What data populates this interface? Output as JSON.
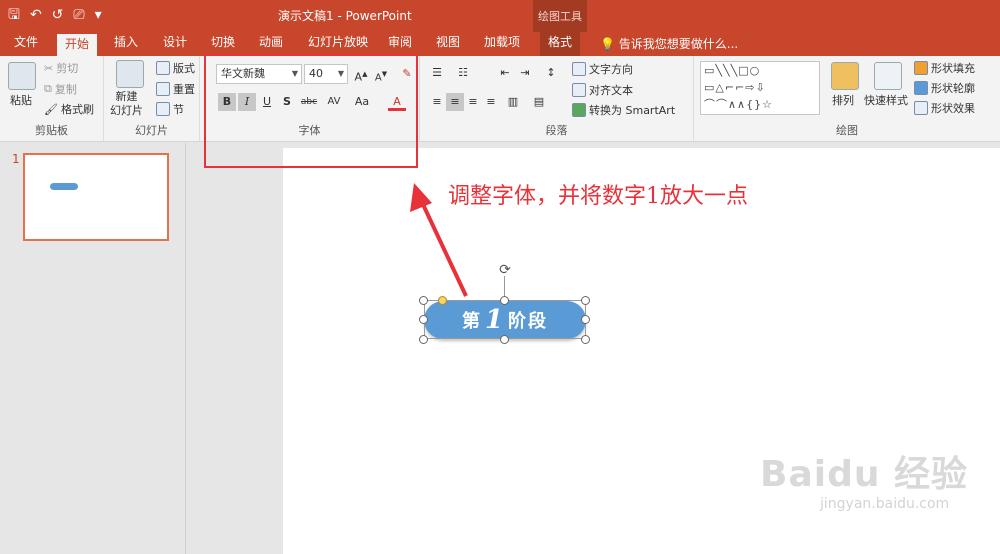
{
  "titlebar": {
    "title": "演示文稿1 - PowerPoint",
    "contextual_group": "绘图工具",
    "qat": {
      "save_icon": "save-icon",
      "undo_icon": "undo-icon",
      "redo_icon": "redo-icon",
      "start_icon": "start-from-beginning-icon",
      "customize": "▾"
    }
  },
  "tabs": [
    {
      "label": "文件"
    },
    {
      "label": "开始"
    },
    {
      "label": "插入"
    },
    {
      "label": "设计"
    },
    {
      "label": "切换"
    },
    {
      "label": "动画"
    },
    {
      "label": "幻灯片放映"
    },
    {
      "label": "审阅"
    },
    {
      "label": "视图"
    },
    {
      "label": "加载项"
    },
    {
      "label": "格式"
    }
  ],
  "tellme": "告诉我您想要做什么...",
  "ribbon": {
    "clipboard": {
      "label": "剪贴板",
      "paste": "粘贴",
      "cut": "剪切",
      "copy": "复制",
      "format_painter": "格式刷"
    },
    "slides": {
      "label": "幻灯片",
      "new_slide": "新建\n幻灯片",
      "layout": "版式",
      "reset": "重置",
      "section": "节"
    },
    "font": {
      "label": "字体",
      "font_name": "华文新魏",
      "font_size": "40",
      "bold": "B",
      "italic": "I",
      "underline": "U",
      "shadow": "S",
      "strike": "abc",
      "spacing": "AV",
      "case": "Aa",
      "color": "A"
    },
    "paragraph": {
      "label": "段落",
      "text_direction": "文字方向",
      "align_text": "对齐文本",
      "convert_smartart": "转换为 SmartArt"
    },
    "drawing": {
      "label": "绘图",
      "arrange": "排列",
      "quick_styles": "快速样式",
      "shape_fill": "形状填充",
      "shape_outline": "形状轮廓",
      "shape_effects": "形状效果"
    }
  },
  "slides_pane": {
    "slide_number": "1"
  },
  "slide": {
    "shape_text_before": "第",
    "shape_text_number": "1",
    "shape_text_after": "阶段"
  },
  "annotation": "调整字体，并将数字1放大一点",
  "watermark": {
    "main": "Baidu 经验",
    "sub": "jingyan.baidu.com"
  },
  "colors": {
    "accent": "#c8462b",
    "shape_fill": "#5b9bd5",
    "annotation": "#e8323a"
  }
}
